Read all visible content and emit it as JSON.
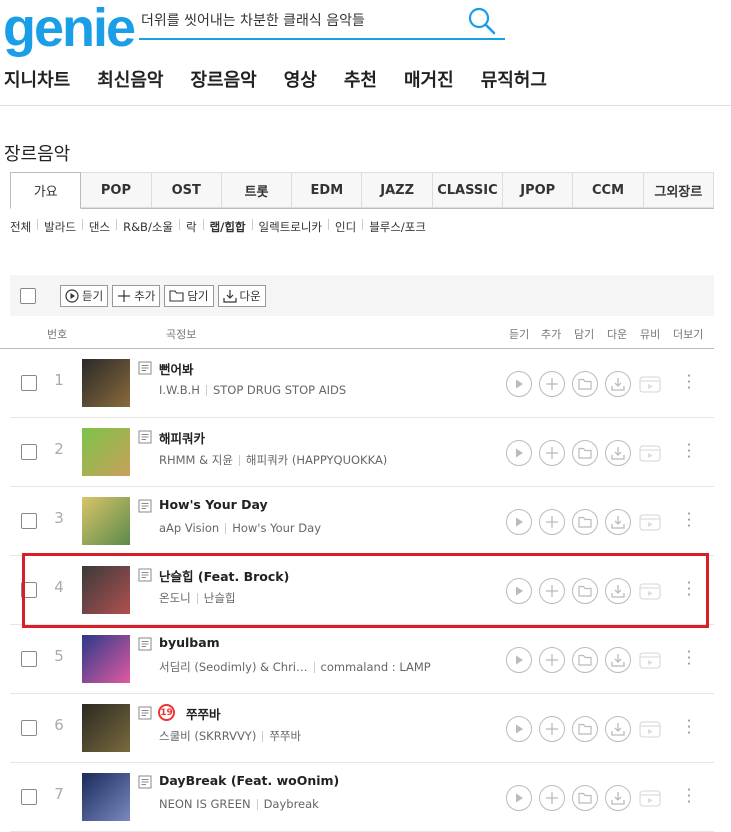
{
  "logo": "genie",
  "search": {
    "value": "더위를 씻어내는 차분한 클래식 음악들"
  },
  "gnb": [
    "지니차트",
    "최신음악",
    "장르음악",
    "영상",
    "추천",
    "매거진",
    "뮤직허그"
  ],
  "page_title": "장르음악",
  "genre_tabs": [
    "가요",
    "POP",
    "OST",
    "트롯",
    "EDM",
    "JAZZ",
    "CLASSIC",
    "JPOP",
    "CCM",
    "그외장르"
  ],
  "active_tab": "가요",
  "sub_genres": [
    "전체",
    "발라드",
    "댄스",
    "R&B/소울",
    "락",
    "랩/힙합",
    "일렉트로니카",
    "인디",
    "블루스/포크"
  ],
  "active_sub": "랩/힙합",
  "toolbar": {
    "play": "듣기",
    "add": "추가",
    "save": "담기",
    "download": "다운"
  },
  "headers": {
    "no": "번호",
    "info": "곡정보",
    "play": "듣기",
    "add": "추가",
    "save": "담기",
    "download": "다운",
    "mv": "뮤비",
    "more": "더보기"
  },
  "rows": [
    {
      "rank": "1",
      "title": "뻔어봐",
      "artist": "I.W.B.H",
      "album": "STOP DRUG STOP AIDS",
      "age19": false
    },
    {
      "rank": "2",
      "title": "해피쿼카",
      "artist": "RHMM & 지윤",
      "album": "해피쿼카 (HAPPYQUOKKA)",
      "age19": false
    },
    {
      "rank": "3",
      "title": "How's Your Day",
      "artist": "aAp Vision",
      "album": "How's Your Day",
      "age19": false
    },
    {
      "rank": "4",
      "title": "난슬힙 (Feat. Brock)",
      "artist": "온도니",
      "album": "난슬힙",
      "age19": false
    },
    {
      "rank": "5",
      "title": "byulbam",
      "artist": "서딤리 (Seodimly) & Chri…",
      "album": "commaland : LAMP",
      "age19": false
    },
    {
      "rank": "6",
      "title": "쭈쭈바",
      "artist": "스쿨비 (SKRRVVY)",
      "album": "쭈쭈바",
      "age19": true,
      "age_label": "19"
    },
    {
      "rank": "7",
      "title": "DayBreak (Feat. woOnim)",
      "artist": "NEON IS GREEN",
      "album": "Daybreak",
      "age19": false
    }
  ],
  "colors": {
    "brand": "#1a9ee8",
    "highlight": "#d81e28"
  }
}
